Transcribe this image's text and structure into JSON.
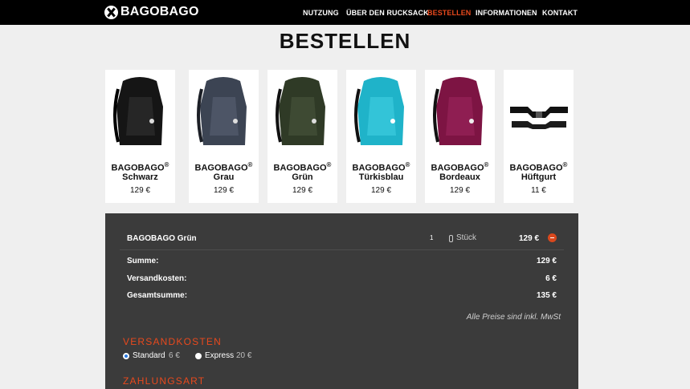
{
  "brand": {
    "logo_text": "BAGOBAGO",
    "logo_icon": "x-circle-icon"
  },
  "nav": {
    "items": [
      {
        "label": "NUTZUNG"
      },
      {
        "label": "ÜBER DEN RUCKSACK"
      },
      {
        "label": "BESTELLEN"
      },
      {
        "label": "INFORMATIONEN"
      },
      {
        "label": "KONTAKT"
      }
    ],
    "active": "BESTELLEN",
    "active_color": "#e8491d"
  },
  "page_title": "BESTELLEN",
  "products": [
    {
      "brand": "BAGOBAGO",
      "reg": "®",
      "color": "Schwarz",
      "price": "129 €",
      "swatch": "#151515"
    },
    {
      "brand": "BAGOBAGO",
      "reg": "®",
      "color": "Grau",
      "price": "129 €",
      "swatch": "#3c4453"
    },
    {
      "brand": "BAGOBAGO",
      "reg": "®",
      "color": "Grün",
      "price": "129 €",
      "swatch": "#2f3a26"
    },
    {
      "brand": "BAGOBAGO",
      "reg": "®",
      "color": "Türkisblau",
      "price": "129 €",
      "swatch": "#1fb3c9"
    },
    {
      "brand": "BAGOBAGO",
      "reg": "®",
      "color": "Bordeaux",
      "price": "129 €",
      "swatch": "#7d1443"
    },
    {
      "brand": "BAGOBAGO",
      "reg": "®",
      "color": "Hüftgurt",
      "price": "11 €",
      "swatch": "#111111"
    }
  ],
  "cart": {
    "item_name": "BAGOBAGO Grün",
    "quantity": "1",
    "unit": "Stück",
    "item_price": "129 €",
    "summary": [
      {
        "label": "Summe:",
        "value": "129 €"
      },
      {
        "label": "Versandkosten:",
        "value": "6 €"
      },
      {
        "label": "Gesamtsumme:",
        "value": "135 €"
      }
    ],
    "tax_note": "Alle Preise sind inkl. MwSt"
  },
  "shipping": {
    "heading": "VERSANDKOSTEN",
    "options": [
      {
        "label": "Standard",
        "price": "6 €",
        "selected": true
      },
      {
        "label": "Express",
        "price": "20 €",
        "selected": false
      }
    ]
  },
  "payment": {
    "heading": "ZAHLUNGSART"
  },
  "colors": {
    "panel": "#3b3b3b",
    "accent": "#e8491d",
    "page_bg": "#efefef"
  }
}
